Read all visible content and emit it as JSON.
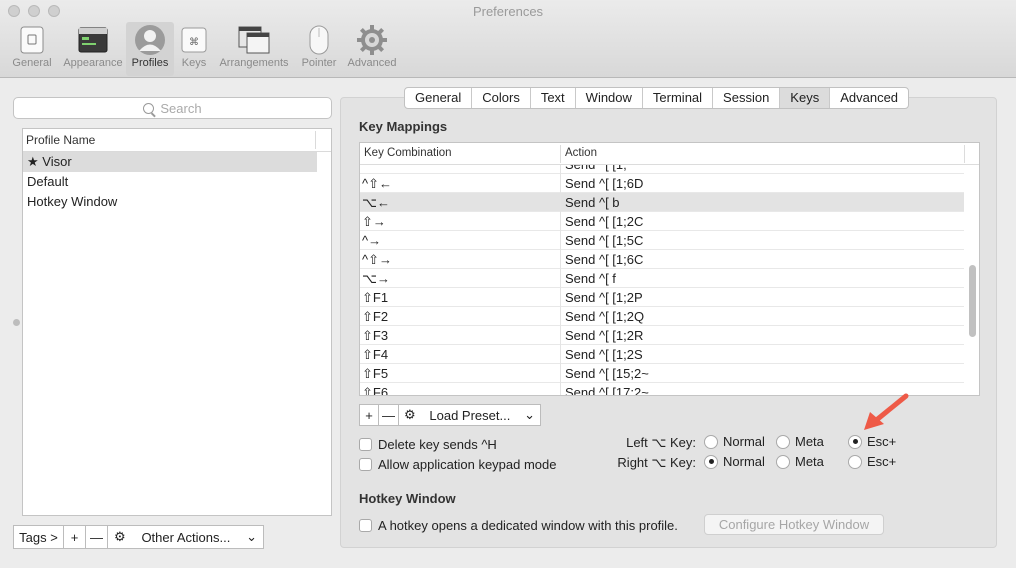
{
  "window": {
    "title": "Preferences"
  },
  "toolbar": {
    "items": [
      {
        "label": "General",
        "icon": "general-icon"
      },
      {
        "label": "Appearance",
        "icon": "appearance-icon"
      },
      {
        "label": "Profiles",
        "icon": "profiles-icon",
        "active": true
      },
      {
        "label": "Keys",
        "icon": "keys-icon"
      },
      {
        "label": "Arrangements",
        "icon": "arrangements-icon"
      },
      {
        "label": "Pointer",
        "icon": "pointer-icon"
      },
      {
        "label": "Advanced",
        "icon": "advanced-gear-icon"
      }
    ]
  },
  "sidebar": {
    "search_placeholder": "Search",
    "column_header": "Profile Name",
    "profiles": [
      "★ Visor",
      "Default",
      "Hotkey Window"
    ],
    "selected": 0,
    "tags_label": "Tags >",
    "add_label": "+",
    "remove_label": "—",
    "other_actions_label": "Other Actions..."
  },
  "tabs": {
    "items": [
      "General",
      "Colors",
      "Text",
      "Window",
      "Terminal",
      "Session",
      "Keys",
      "Advanced"
    ],
    "active": "Keys"
  },
  "key_mappings": {
    "title": "Key Mappings",
    "col_combination": "Key Combination",
    "col_action": "Action",
    "partial_row": "Send ^[ [1;",
    "rows": [
      {
        "key": "^⇧←",
        "action": "Send ^[ [1;6D"
      },
      {
        "key": "⌥←",
        "action": "Send ^[ b",
        "selected": true
      },
      {
        "key": "⇧→",
        "action": "Send ^[ [1;2C"
      },
      {
        "key": "^→",
        "action": "Send ^[ [1;5C"
      },
      {
        "key": "^⇧→",
        "action": "Send ^[ [1;6C"
      },
      {
        "key": "⌥→",
        "action": "Send ^[ f"
      },
      {
        "key": "⇧F1",
        "action": "Send ^[ [1;2P"
      },
      {
        "key": "⇧F2",
        "action": "Send ^[ [1;2Q"
      },
      {
        "key": "⇧F3",
        "action": "Send ^[ [1;2R"
      },
      {
        "key": "⇧F4",
        "action": "Send ^[ [1;2S"
      },
      {
        "key": "⇧F5",
        "action": "Send ^[ [15;2~"
      },
      {
        "key": "⇧F6",
        "action": "Send ^[ [17;2~"
      }
    ],
    "add_label": "+",
    "remove_label": "—",
    "load_preset_label": "Load Preset...",
    "delete_sends_label": "Delete key sends ^H",
    "keypad_mode_label": "Allow application keypad mode"
  },
  "option_keys": {
    "left_label": "Left ⌥ Key:",
    "right_label": "Right ⌥ Key:",
    "options": [
      "Normal",
      "Meta",
      "Esc+"
    ],
    "left_selected": "Esc+",
    "right_selected": "Normal"
  },
  "hotkey": {
    "title": "Hotkey Window",
    "checkbox_label": "A hotkey opens a dedicated window with this profile.",
    "configure_label": "Configure Hotkey Window"
  },
  "colors": {
    "arrow": "#ee5a47"
  }
}
